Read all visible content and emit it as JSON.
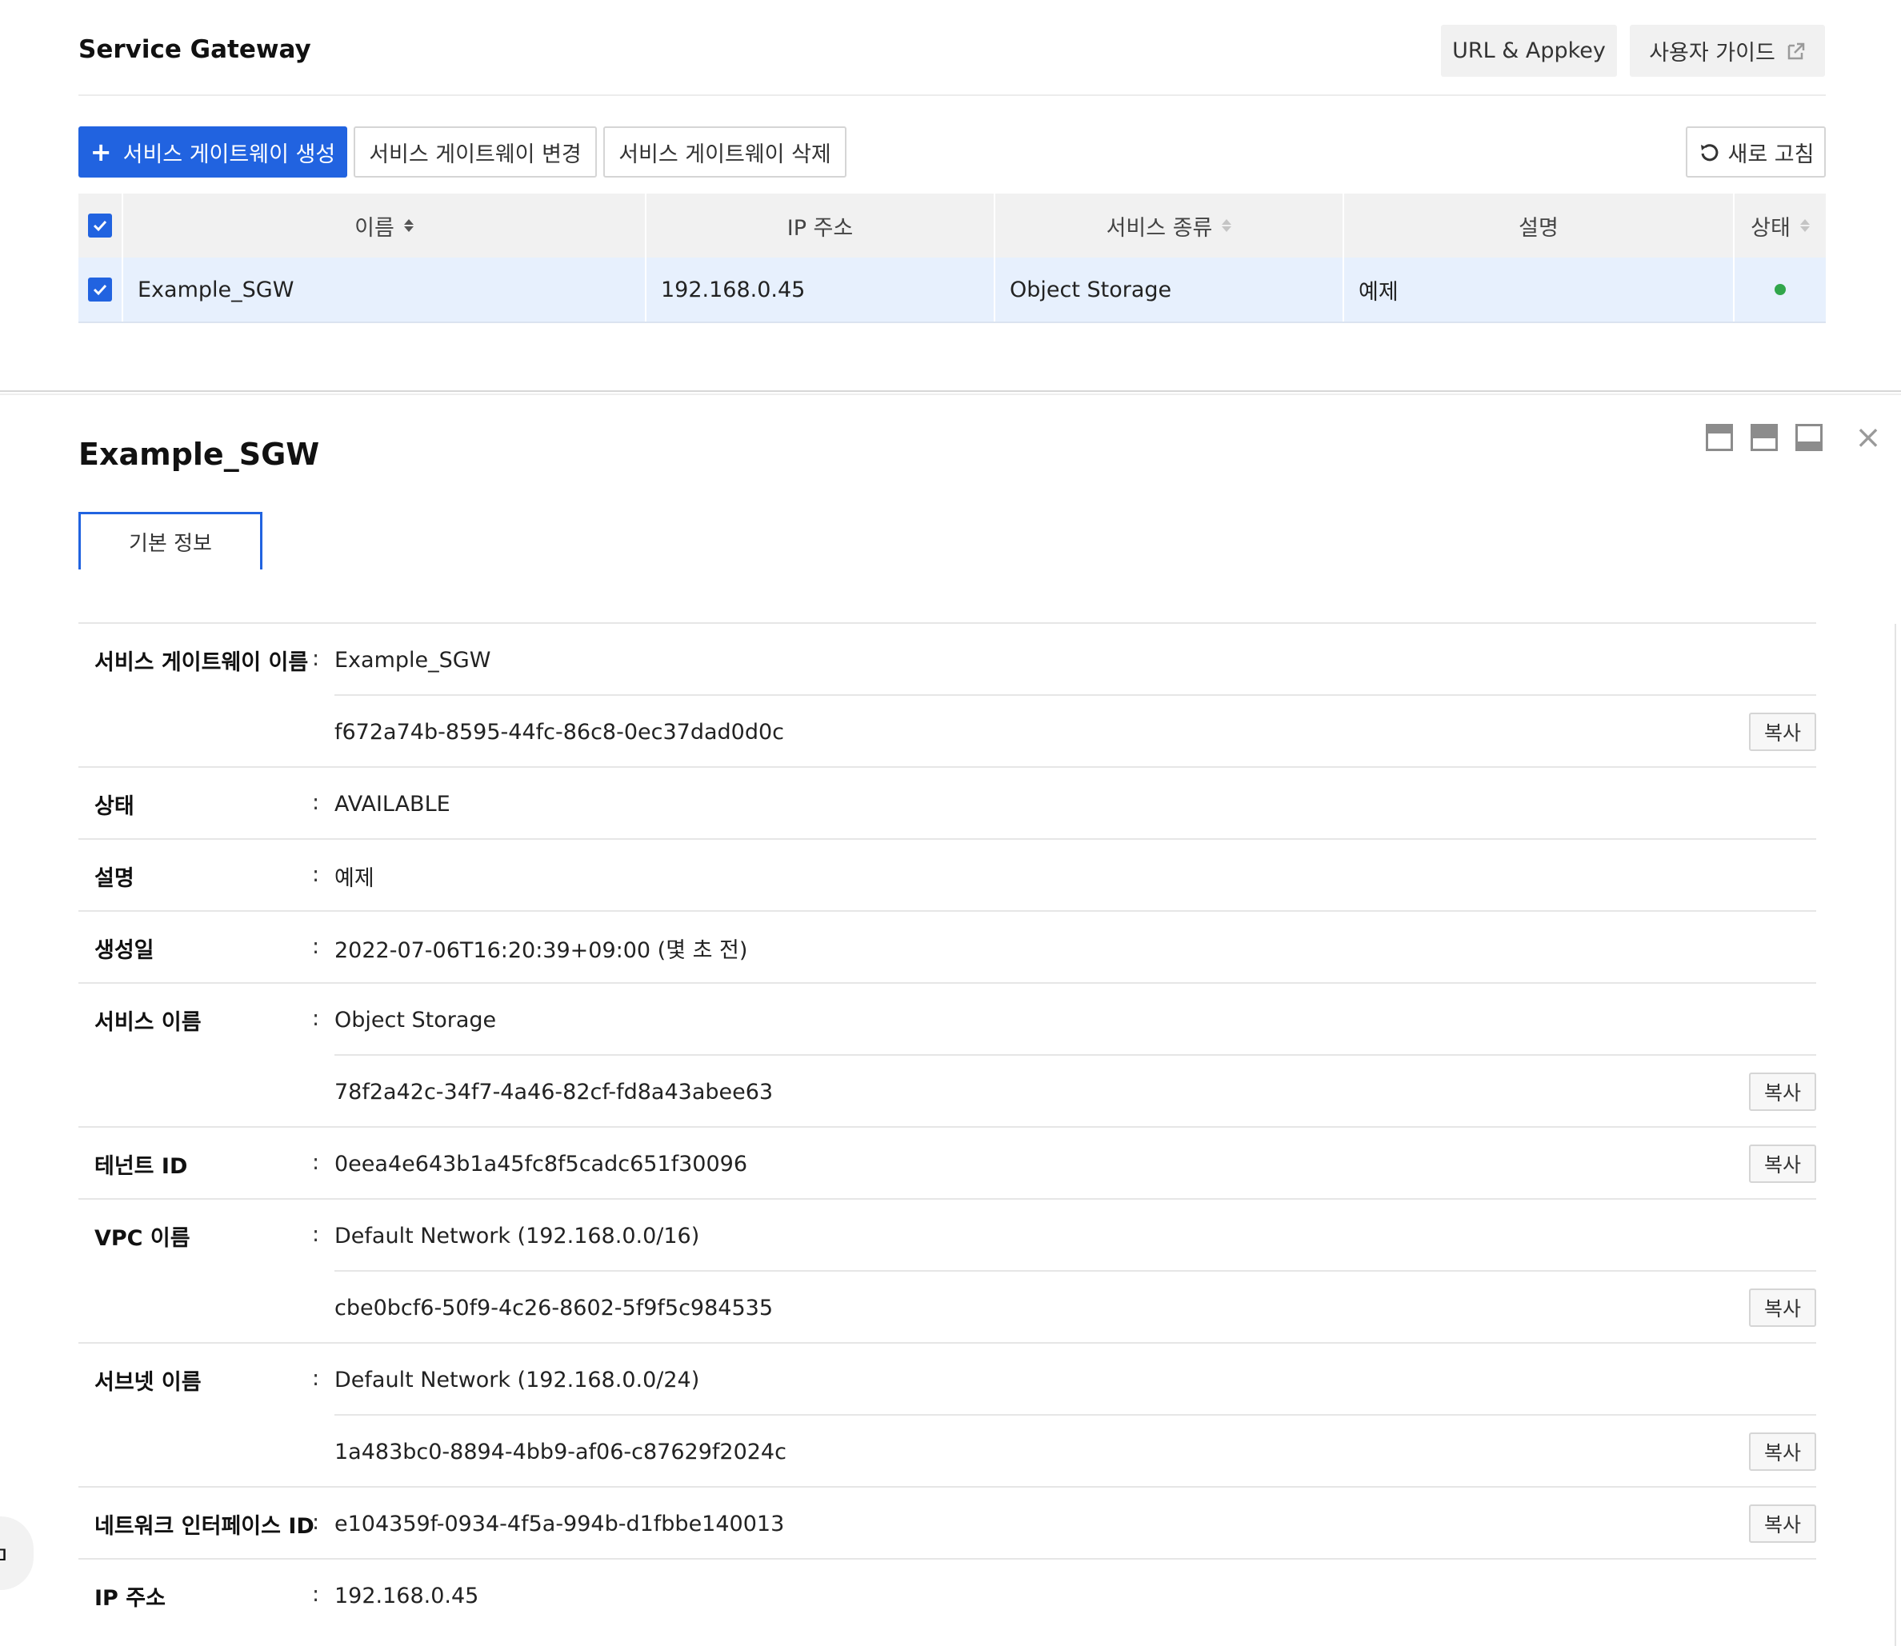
{
  "header": {
    "title": "Service Gateway",
    "url_appkey_label": "URL & Appkey",
    "user_guide_label": "사용자 가이드"
  },
  "toolbar": {
    "create_label": "서비스 게이트웨이 생성",
    "edit_label": "서비스 게이트웨이 변경",
    "delete_label": "서비스 게이트웨이 삭제",
    "refresh_label": "새로 고침"
  },
  "table": {
    "columns": [
      "이름",
      "IP 주소",
      "서비스 종류",
      "설명",
      "상태"
    ],
    "rows": [
      {
        "name": "Example_SGW",
        "ip": "192.168.0.45",
        "service": "Object Storage",
        "desc": "예제",
        "status": "AVAILABLE",
        "selected": true
      }
    ]
  },
  "detail": {
    "title": "Example_SGW",
    "tab_label": "기본 정보",
    "copy_label": "복사",
    "fields": {
      "gw_name": {
        "label": "서비스 게이트웨이 이름",
        "value": "Example_SGW",
        "id": "f672a74b-8595-44fc-86c8-0ec37dad0d0c"
      },
      "status": {
        "label": "상태",
        "value": "AVAILABLE"
      },
      "desc": {
        "label": "설명",
        "value": "예제"
      },
      "created": {
        "label": "생성일",
        "value": "2022-07-06T16:20:39+09:00 (몇 초 전)"
      },
      "service": {
        "label": "서비스 이름",
        "value": "Object Storage",
        "id": "78f2a42c-34f7-4a46-82cf-fd8a43abee63"
      },
      "tenant": {
        "label": "테넌트 ID",
        "value": "0eea4e643b1a45fc8f5cadc651f30096"
      },
      "vpc": {
        "label": "VPC 이름",
        "value": "Default Network (192.168.0.0/16)",
        "id": "cbe0bcf6-50f9-4c26-8602-5f9f5c984535"
      },
      "subnet": {
        "label": "서브넷 이름",
        "value": "Default Network (192.168.0.0/24)",
        "id": "1a483bc0-8894-4bb9-af06-c87629f2024c"
      },
      "nic": {
        "label": "네트워크 인터페이스 ID",
        "value": "e104359f-0934-4f5a-994b-d1fbbe140013"
      },
      "ip": {
        "label": "IP 주소",
        "value": "192.168.0.45"
      }
    }
  },
  "colors": {
    "accent": "#2163e0",
    "selected_row": "#e7f0fd",
    "status_ok": "#31a64b"
  },
  "icons": [
    "plus-icon",
    "external-link-icon",
    "refresh-icon",
    "checkbox-checked-icon",
    "sort-icon",
    "status-dot-icon",
    "layout-top-icon",
    "layout-half-icon",
    "layout-bottom-icon",
    "close-icon"
  ]
}
